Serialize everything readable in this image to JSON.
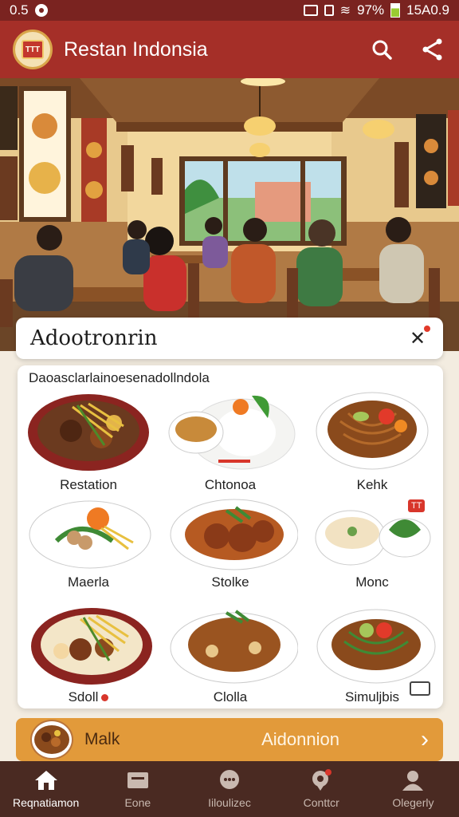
{
  "status_bar": {
    "time": "0.5",
    "battery": "97%",
    "clock": "15A0.9"
  },
  "app_bar": {
    "title": "Restan Indonsia",
    "logo_text": "TTT"
  },
  "section": {
    "title": "Adootronrin"
  },
  "menu": {
    "subtitle": "Daoasclarlainoesenadollndola",
    "dishes": [
      {
        "label": "Restation"
      },
      {
        "label": "Chtonoa"
      },
      {
        "label": "Kehk"
      },
      {
        "label": "Maerla"
      },
      {
        "label": "Stolke"
      },
      {
        "label": "Monc",
        "badge": "TT"
      },
      {
        "label": "Sdoll"
      },
      {
        "label": "Clolla"
      },
      {
        "label": "Simuljbis"
      }
    ]
  },
  "promo": {
    "left_label": "Malk",
    "center_label": "Aidonnion"
  },
  "bottom_nav": [
    {
      "label": "Reqnatiamon",
      "icon": "home-icon"
    },
    {
      "label": "Eone",
      "icon": "card-icon"
    },
    {
      "label": "Iiloulizec",
      "icon": "chat-bubble-icon"
    },
    {
      "label": "Conttcr",
      "icon": "location-pin-icon"
    },
    {
      "label": "Olegerly",
      "icon": "people-icon"
    }
  ],
  "colors": {
    "primary": "#a52f28",
    "status_bar": "#7a2320",
    "accent": "#e29a3a",
    "nav": "#4a2a22"
  }
}
